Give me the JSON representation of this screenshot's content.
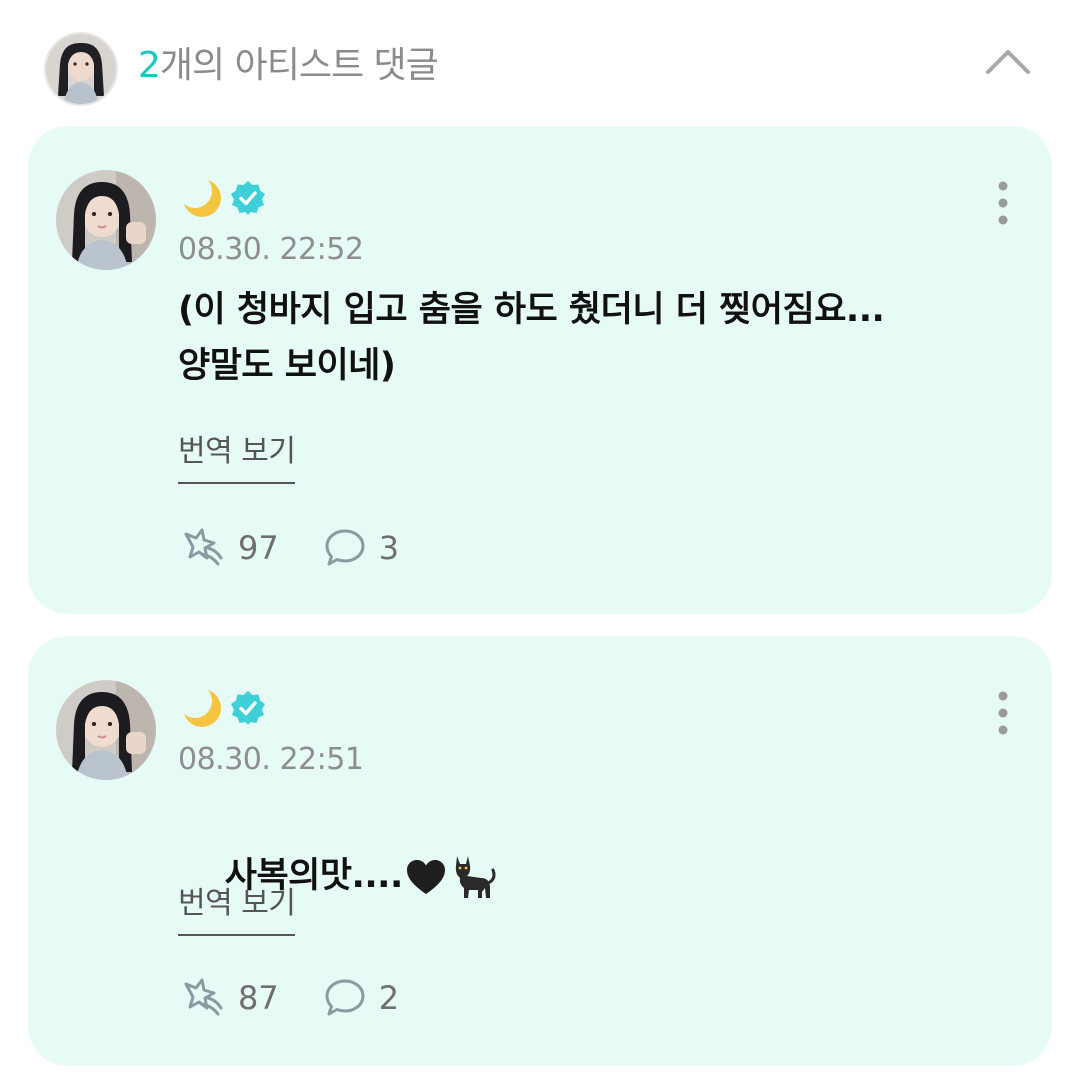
{
  "header": {
    "count": "2",
    "title_suffix": "개의 아티스트 댓글",
    "avatar_icon": "artist-avatar",
    "collapse_icon": "chevron-up-icon"
  },
  "colors": {
    "accent": "#1fc6c0",
    "card_bg": "#e6fbf6",
    "verified": "#3ecfd8",
    "text_muted": "#8e8e8e"
  },
  "comments": [
    {
      "name_icon": "crescent-moon-emoji",
      "verified_icon": "verified-badge-icon",
      "timestamp": "08.30. 22:52",
      "text": "(이 청바지 입고 춤을 하도 췄더니 더 찢어짐요...\n양말도 보이네)",
      "translate_label": "번역 보기",
      "like_count": "97",
      "reply_count": "3"
    },
    {
      "name_icon": "crescent-moon-emoji",
      "verified_icon": "verified-badge-icon",
      "timestamp": "08.30. 22:51",
      "text": "사복의맛....",
      "text_emojis": [
        "black-heart-emoji",
        "black-cat-emoji"
      ],
      "translate_label": "번역 보기",
      "like_count": "87",
      "reply_count": "2"
    }
  ]
}
